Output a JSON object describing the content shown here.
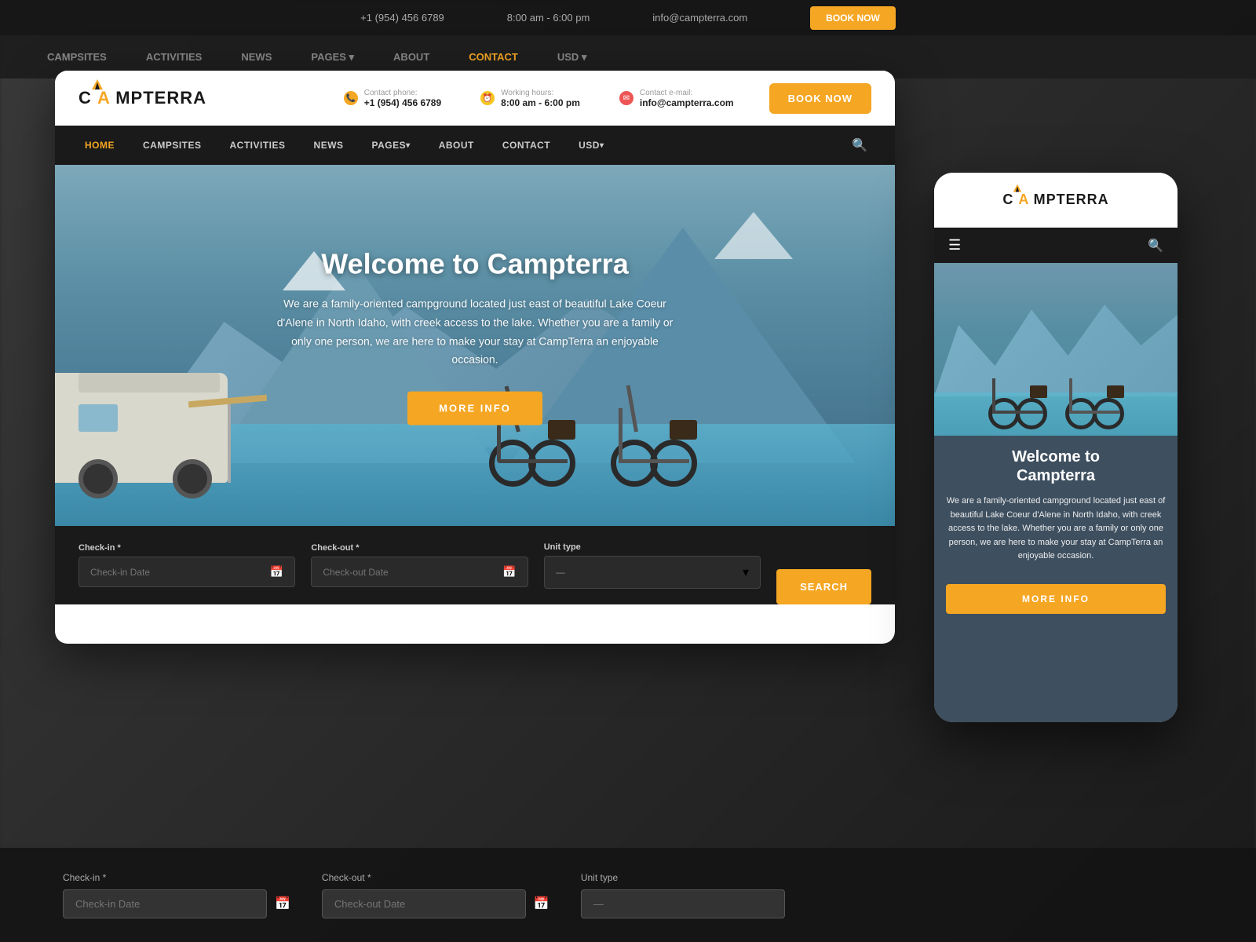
{
  "site": {
    "name": "CAMPTERRA",
    "logo_accent_char": "Â",
    "tagline": "Welcome to Campterra"
  },
  "top_bar": {
    "phone_label": "Contact phone:",
    "phone": "+1 (954) 456 6789",
    "hours_label": "Working hours:",
    "hours": "8:00 am - 6:00 pm",
    "email_label": "Contact e-mail:",
    "email": "info@campterra.com",
    "book_btn": "BOOK NOW"
  },
  "nav": {
    "items": [
      {
        "label": "HOME",
        "active": true
      },
      {
        "label": "CAMPSITES",
        "active": false
      },
      {
        "label": "ACTIVITIES",
        "active": false
      },
      {
        "label": "NEWS",
        "active": false
      },
      {
        "label": "PAGES",
        "active": false,
        "has_arrow": true
      },
      {
        "label": "ABOUT",
        "active": false
      },
      {
        "label": "CONTACT",
        "active": false
      },
      {
        "label": "USD",
        "active": false,
        "has_arrow": true
      }
    ]
  },
  "hero": {
    "title": "Welcome to Campterra",
    "description": "We are a family-oriented campground located just east of beautiful Lake Coeur d'Alene in North Idaho, with creek access to the lake. Whether you are a family or only one person, we are here to make your stay at CampTerra an enjoyable occasion.",
    "more_info_btn": "MORE INFO"
  },
  "booking": {
    "checkin_label": "Check-in *",
    "checkin_placeholder": "Check-in Date",
    "checkout_label": "Check-out *",
    "checkout_placeholder": "Check-out Date",
    "unit_type_label": "Unit type",
    "unit_type_default": "—",
    "search_btn": "SEARCH"
  },
  "mobile": {
    "title": "Welcome to\nCampterra",
    "description": "We are a family-oriented campground located just east of beautiful Lake Coeur d'Alene in North Idaho, with creek access to the lake. Whether you are a family or only one person, we are here to make your stay at CampTerra an enjoyable occasion.",
    "more_info_btn": "MORE INFO",
    "hamburger": "☰",
    "search": "🔍"
  },
  "bg_nav": {
    "items": [
      "CAMPSITES",
      "ACTIVITIES",
      "NEWS",
      "PAGES ▾",
      "ABOUT",
      "CONTACT",
      "USD ▾"
    ]
  },
  "colors": {
    "accent": "#f5a623",
    "dark": "#1a1a1a",
    "nav_dark": "#1a1a1a"
  }
}
